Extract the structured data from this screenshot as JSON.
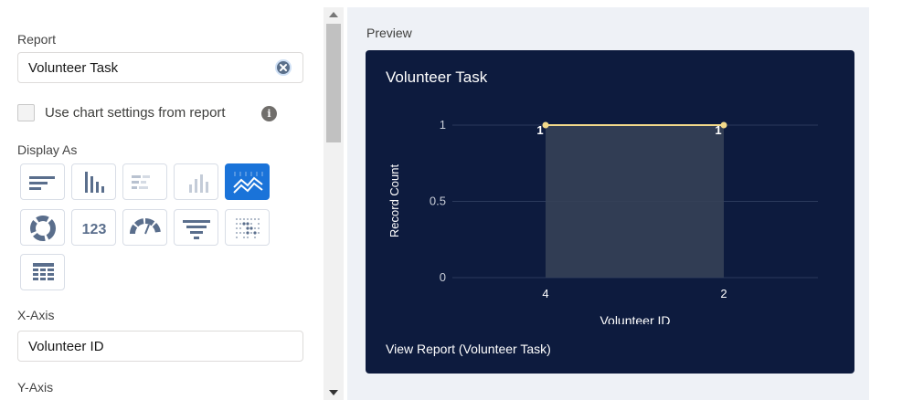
{
  "settings": {
    "report_label": "Report",
    "report_value": "Volunteer Task",
    "use_chart_settings_label": "Use chart settings from report",
    "info_icon_glyph": "i",
    "display_as_label": "Display As",
    "display_options": [
      {
        "name": "horizontal-bar-icon",
        "selected": false
      },
      {
        "name": "vertical-bar-icon",
        "selected": false
      },
      {
        "name": "stacked-horizontal-bar-icon",
        "selected": false
      },
      {
        "name": "stacked-vertical-bar-icon",
        "selected": false
      },
      {
        "name": "line-chart-icon",
        "selected": true
      },
      {
        "name": "donut-icon",
        "selected": false
      },
      {
        "name": "metric-icon",
        "selected": false,
        "text": "123"
      },
      {
        "name": "gauge-icon",
        "selected": false
      },
      {
        "name": "funnel-icon",
        "selected": false
      },
      {
        "name": "scatter-icon",
        "selected": false
      },
      {
        "name": "table-icon",
        "selected": false
      }
    ],
    "x_axis_label": "X-Axis",
    "x_axis_value": "Volunteer ID",
    "y_axis_label": "Y-Axis"
  },
  "preview": {
    "label": "Preview",
    "chart_title": "Volunteer Task",
    "view_report_link": "View Report (Volunteer Task)"
  },
  "chart_data": {
    "type": "line",
    "title": "Volunteer Task",
    "categories": [
      "4",
      "2"
    ],
    "series": [
      {
        "values": [
          1,
          1
        ]
      }
    ],
    "data_labels": [
      "1",
      "1"
    ],
    "xlabel": "Volunteer ID",
    "ylabel": "Record Count",
    "ylim": [
      0,
      1
    ],
    "yticks": [
      "0",
      "0.5",
      "1"
    ],
    "grid": true,
    "colors": {
      "line": "#f2d98a",
      "area": "#354157",
      "background": "#0d1b3e",
      "text": "#ffffff",
      "axis_text": "#c9ced8",
      "grid": "#2b3a5c"
    }
  }
}
